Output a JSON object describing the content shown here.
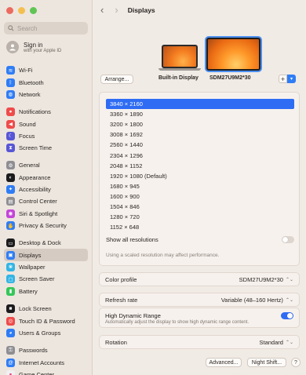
{
  "search": {
    "placeholder": "Search"
  },
  "account": {
    "title": "Sign in",
    "subtitle": "with your Apple ID"
  },
  "sidebar": {
    "groups": [
      [
        {
          "label": "Wi-Fi",
          "icon": "wifi-icon",
          "color": "#2f7df6"
        },
        {
          "label": "Bluetooth",
          "icon": "bluetooth-icon",
          "color": "#2f7df6"
        },
        {
          "label": "Network",
          "icon": "network-icon",
          "color": "#2f7df6"
        }
      ],
      [
        {
          "label": "Notifications",
          "icon": "bell-icon",
          "color": "#ef4b4b"
        },
        {
          "label": "Sound",
          "icon": "speaker-icon",
          "color": "#ef4b4b"
        },
        {
          "label": "Focus",
          "icon": "moon-icon",
          "color": "#5856d6"
        },
        {
          "label": "Screen Time",
          "icon": "hourglass-icon",
          "color": "#5856d6"
        }
      ],
      [
        {
          "label": "General",
          "icon": "gear-icon",
          "color": "#8e8e93"
        },
        {
          "label": "Appearance",
          "icon": "appearance-icon",
          "color": "#1c1c1e"
        },
        {
          "label": "Accessibility",
          "icon": "accessibility-icon",
          "color": "#2f7df6"
        },
        {
          "label": "Control Center",
          "icon": "control-center-icon",
          "color": "#8e8e93"
        },
        {
          "label": "Siri & Spotlight",
          "icon": "siri-icon",
          "color": "#c445d9"
        },
        {
          "label": "Privacy & Security",
          "icon": "hand-icon",
          "color": "#2f7df6"
        }
      ],
      [
        {
          "label": "Desktop & Dock",
          "icon": "dock-icon",
          "color": "#1c1c1e"
        },
        {
          "label": "Displays",
          "icon": "display-icon",
          "color": "#2f7df6",
          "selected": true
        },
        {
          "label": "Wallpaper",
          "icon": "wallpaper-icon",
          "color": "#33b5e5"
        },
        {
          "label": "Screen Saver",
          "icon": "screensaver-icon",
          "color": "#33b5e5"
        },
        {
          "label": "Battery",
          "icon": "battery-icon",
          "color": "#34c759"
        }
      ],
      [
        {
          "label": "Lock Screen",
          "icon": "lock-icon",
          "color": "#1c1c1e"
        },
        {
          "label": "Touch ID & Password",
          "icon": "fingerprint-icon",
          "color": "#ef4b4b"
        },
        {
          "label": "Users & Groups",
          "icon": "users-icon",
          "color": "#2f7df6"
        }
      ],
      [
        {
          "label": "Passwords",
          "icon": "key-icon",
          "color": "#8e8e93"
        },
        {
          "label": "Internet Accounts",
          "icon": "at-icon",
          "color": "#2f7df6"
        },
        {
          "label": "Game Center",
          "icon": "game-center-icon",
          "color": "#f1f1f1"
        }
      ]
    ]
  },
  "header": {
    "title": "Displays"
  },
  "displays": {
    "arrange_label": "Arrange...",
    "builtin_label": "Built-in Display",
    "external_label": "SDM27U9M2*30",
    "plus_label": "+"
  },
  "resolutions": {
    "items": [
      "3840 × 2160",
      "3360 × 1890",
      "3200 × 1800",
      "3008 × 1692",
      "2560 × 1440",
      "2304 × 1296",
      "2048 × 1152",
      "1920 × 1080 (Default)",
      "1680 × 945",
      "1600 × 900",
      "1504 × 846",
      "1280 × 720",
      "1152 × 648"
    ],
    "selected_index": 0,
    "show_all_label": "Show all resolutions",
    "show_all_on": false,
    "note": "Using a scaled resolution may affect performance."
  },
  "settings": {
    "color_profile_label": "Color profile",
    "color_profile_value": "SDM27U9M2*30",
    "refresh_label": "Refresh rate",
    "refresh_value": "Variable (48–160 Hertz)",
    "hdr_label": "High Dynamic Range",
    "hdr_desc": "Automatically adjust the display to show high dynamic range content.",
    "hdr_on": true,
    "rotation_label": "Rotation",
    "rotation_value": "Standard"
  },
  "footer": {
    "advanced_label": "Advanced...",
    "night_shift_label": "Night Shift...",
    "help_label": "?"
  }
}
